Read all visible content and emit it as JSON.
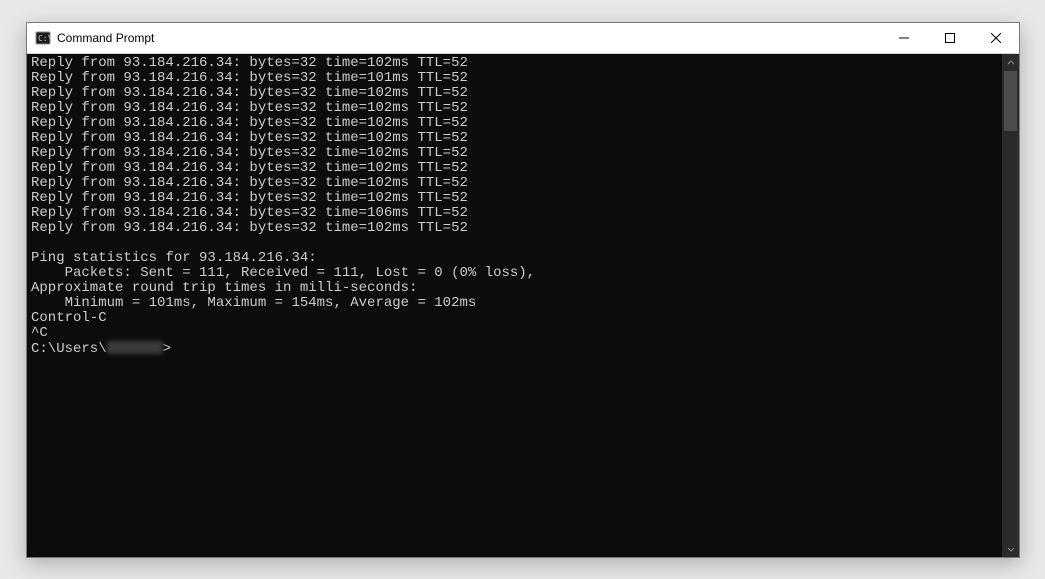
{
  "window": {
    "title": "Command Prompt"
  },
  "terminal": {
    "replies": [
      "Reply from 93.184.216.34: bytes=32 time=102ms TTL=52",
      "Reply from 93.184.216.34: bytes=32 time=101ms TTL=52",
      "Reply from 93.184.216.34: bytes=32 time=102ms TTL=52",
      "Reply from 93.184.216.34: bytes=32 time=102ms TTL=52",
      "Reply from 93.184.216.34: bytes=32 time=102ms TTL=52",
      "Reply from 93.184.216.34: bytes=32 time=102ms TTL=52",
      "Reply from 93.184.216.34: bytes=32 time=102ms TTL=52",
      "Reply from 93.184.216.34: bytes=32 time=102ms TTL=52",
      "Reply from 93.184.216.34: bytes=32 time=102ms TTL=52",
      "Reply from 93.184.216.34: bytes=32 time=102ms TTL=52",
      "Reply from 93.184.216.34: bytes=32 time=106ms TTL=52",
      "Reply from 93.184.216.34: bytes=32 time=102ms TTL=52"
    ],
    "stats_header": "Ping statistics for 93.184.216.34:",
    "packets_line": "    Packets: Sent = 111, Received = 111, Lost = 0 (0% loss),",
    "rtt_header": "Approximate round trip times in milli-seconds:",
    "rtt_line": "    Minimum = 101ms, Maximum = 154ms, Average = 102ms",
    "control_c": "Control-C",
    "caret_c": "^C",
    "prompt_prefix": "C:\\Users\\",
    "prompt_suffix": ">"
  }
}
